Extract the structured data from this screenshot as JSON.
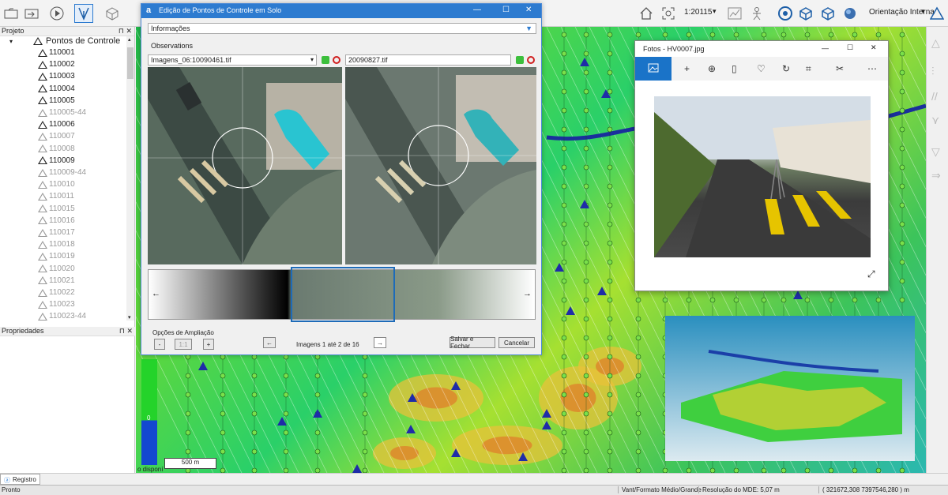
{
  "toolbar": {
    "scale_value": "1:20115",
    "orientation": "Orientação Interna",
    "icons": [
      "folder-icon",
      "import-icon",
      "play-icon",
      "vector-icon",
      "cube-icon",
      "home-icon",
      "zoom-extent-icon",
      "chart-icon",
      "target-icon",
      "cube-3d-icon",
      "sphere-icon",
      "orientation-icon"
    ]
  },
  "project_panel": {
    "title": "Projeto",
    "root_label": "Pontos de Controle",
    "items": [
      {
        "label": "110001",
        "dim": false
      },
      {
        "label": "110002",
        "dim": false
      },
      {
        "label": "110003",
        "dim": false
      },
      {
        "label": "110004",
        "dim": false
      },
      {
        "label": "110005",
        "dim": false
      },
      {
        "label": "110005-44",
        "dim": true
      },
      {
        "label": "110006",
        "dim": false
      },
      {
        "label": "110007",
        "dim": true
      },
      {
        "label": "110008",
        "dim": true
      },
      {
        "label": "110009",
        "dim": false
      },
      {
        "label": "110009-44",
        "dim": true
      },
      {
        "label": "110010",
        "dim": true
      },
      {
        "label": "110011",
        "dim": true
      },
      {
        "label": "110015",
        "dim": true
      },
      {
        "label": "110016",
        "dim": true
      },
      {
        "label": "110017",
        "dim": true
      },
      {
        "label": "110018",
        "dim": true
      },
      {
        "label": "110019",
        "dim": true
      },
      {
        "label": "110020",
        "dim": true
      },
      {
        "label": "110021",
        "dim": true
      },
      {
        "label": "110022",
        "dim": true
      },
      {
        "label": "110023",
        "dim": true
      },
      {
        "label": "110023-44",
        "dim": true
      }
    ]
  },
  "properties_panel": {
    "title": "Propriedades"
  },
  "dialog": {
    "title": "Edição de Pontos de Controle em Solo",
    "section": "Informações",
    "observations_label": "Observations",
    "left_image": "Imagens_06:10090461.tif",
    "right_image": "20090827.tif",
    "zoom_label": "Opções de Ampliação",
    "zoom_minus": "-",
    "zoom_value": "1:1",
    "zoom_plus": "+",
    "nav_label": "Imagens 1 até 2 de 16",
    "save_label": "Salvar e Fechar",
    "cancel_label": "Cancelar"
  },
  "photos_window": {
    "title": "Fotos - HV0007.jpg"
  },
  "legend": {
    "value": "0",
    "side_text": "o disponí"
  },
  "map": {
    "scale_bar": "500 m"
  },
  "bottom_tab": {
    "label": "Registro"
  },
  "status": {
    "left": "Pronto",
    "format": "Vant/Formato Médio/Grande",
    "resolution": "Resolução do MDE: 5,07 m",
    "coords": "( 321672,308 7397546,280 ) m"
  },
  "colors": {
    "accent": "#2d7bd0",
    "map_green": "#2ad069"
  }
}
